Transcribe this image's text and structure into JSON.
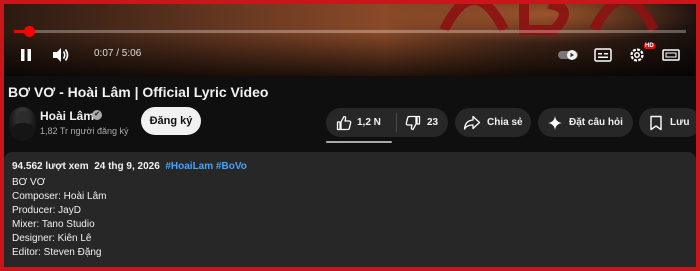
{
  "player": {
    "time": "0:07 / 5:06",
    "progress_fraction": 0.023,
    "icons": [
      "pause-icon",
      "volume-icon",
      "autoplay-toggle-icon",
      "subtitles-icon",
      "settings-icon",
      "theater-mode-icon"
    ],
    "settings_badge": "HD"
  },
  "video": {
    "title": "BƠ VƠ - Hoài Lâm | Official Lyric Video"
  },
  "channel": {
    "name": "Hoài Lâm",
    "verified_icon": "✔",
    "subscribers": "1,82 Tr người đăng ký",
    "subscribe_label": "Đăng ký"
  },
  "actions": {
    "like_count": "1,2 N",
    "dislike_count": "23",
    "share_label": "Chia sẻ",
    "ask_label": "Đặt câu hỏi",
    "save_label": "Lưu"
  },
  "description": {
    "views": "94.562 lượt xem",
    "date": "24 thg 9, 2026",
    "hashtags": [
      "#HoaiLam",
      "#BoVo"
    ],
    "lines": [
      "BƠ VƠ",
      "Composer: Hoài Lâm",
      "Producer: JayD",
      "Mixer: Tano Studio",
      "Designer: Kiên Lê",
      "Editor: Steven Đặng"
    ]
  },
  "colors": {
    "accent": "#ff0000",
    "link": "#3ea6ff",
    "background": "#0f0f0f",
    "surface": "#272727",
    "frame": "#c8161a"
  }
}
